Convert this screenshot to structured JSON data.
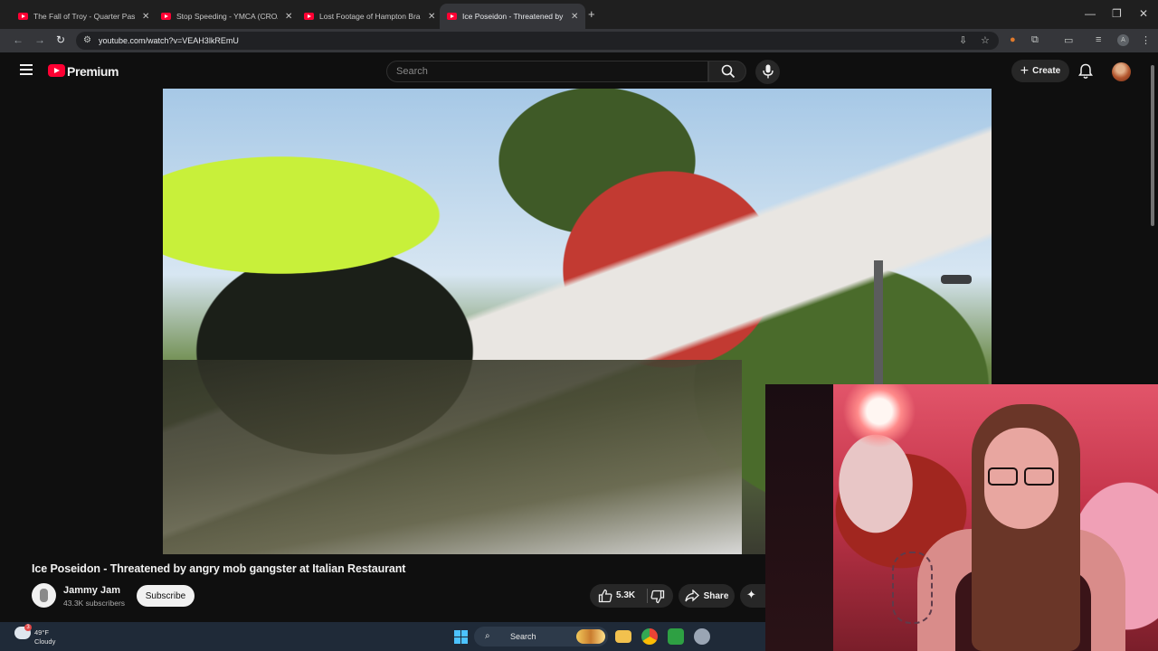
{
  "browser": {
    "tabs": [
      {
        "title": "The Fall of Troy - Quarter Past",
        "active": false
      },
      {
        "title": "Stop Speeding - YMCA (CROAK",
        "active": false
      },
      {
        "title": "Lost Footage of Hampton Bran",
        "active": false
      },
      {
        "title": "Ice Poseidon - Threatened by a",
        "active": true
      }
    ],
    "new_tab": "+",
    "close_glyph": "✕",
    "window": {
      "minimize": "—",
      "restore": "❐",
      "close": "✕"
    },
    "url": "youtube.com/watch?v=VEAH3lkREmU",
    "profile_letter": "A"
  },
  "youtube": {
    "brand": "Premium",
    "search_placeholder": "Search",
    "create_label": "Create",
    "icons": [
      "menu-icon",
      "youtube-logo-icon",
      "search-icon",
      "mic-icon",
      "plus-icon",
      "bell-icon"
    ]
  },
  "video": {
    "title": "Ice Poseidon - Threatened by angry mob gangster at Italian Restaurant",
    "channel": "Jammy Jam",
    "subscribers": "43.3K subscribers",
    "subscribe_label": "Subscribe",
    "likes": "5.3K",
    "share_label": "Share",
    "more_glyph": "✦"
  },
  "taskbar": {
    "temperature": "49°F",
    "condition": "Cloudy",
    "notification_count": "3",
    "search_label": "Search"
  },
  "colors": {
    "youtube_red": "#ff0033",
    "background": "#0f0f0f",
    "chip": "#272727",
    "taskbar": "#1f2a38"
  }
}
